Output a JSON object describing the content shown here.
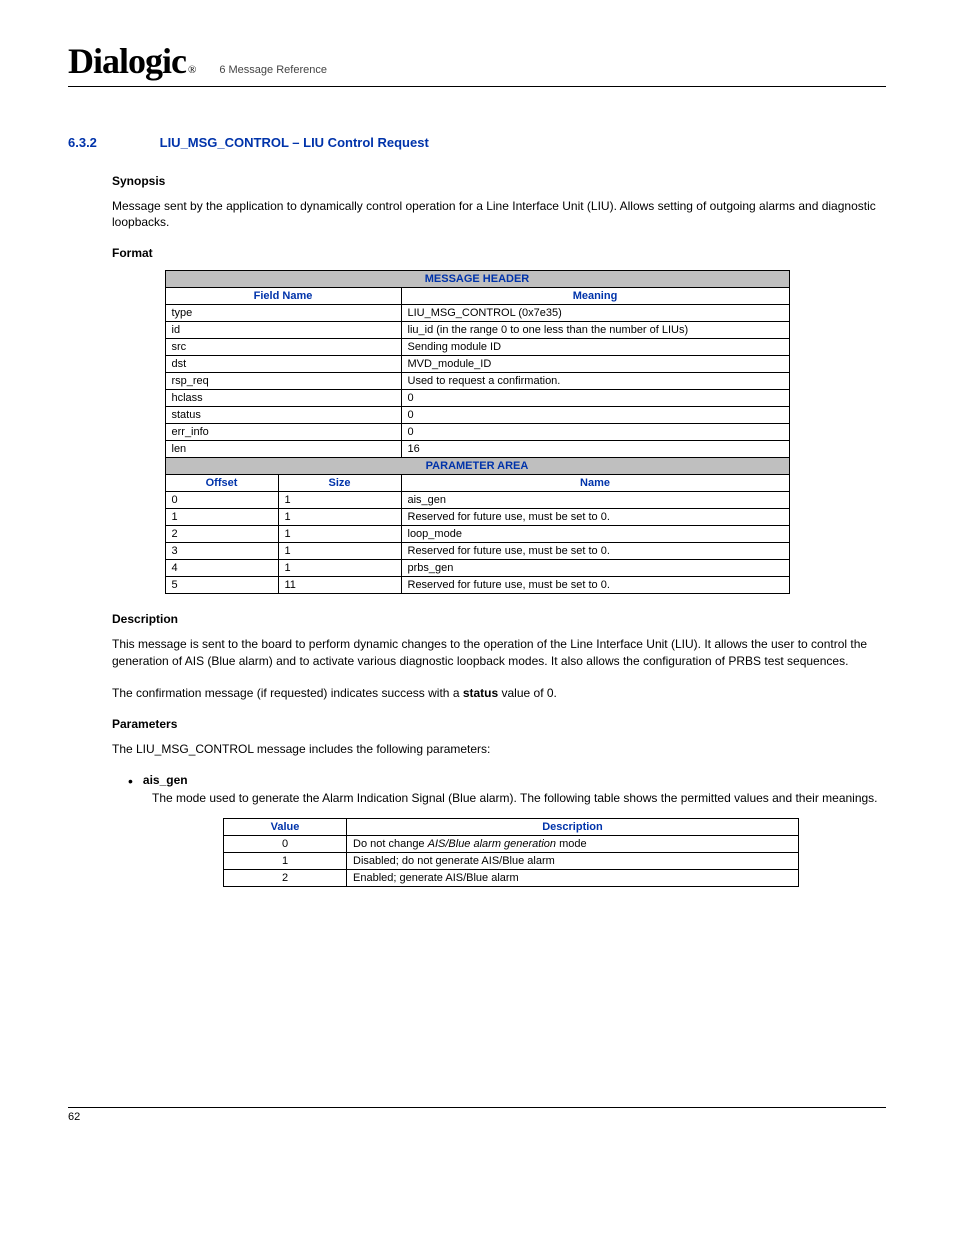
{
  "header": {
    "logo": "Dialogic",
    "breadcrumb": "6 Message Reference"
  },
  "section": {
    "number": "6.3.2",
    "title": "LIU_MSG_CONTROL – LIU Control Request"
  },
  "synopsis": {
    "heading": "Synopsis",
    "text": "Message sent by the application to dynamically control operation for a Line Interface Unit (LIU). Allows setting of outgoing alarms and diagnostic loopbacks."
  },
  "format": {
    "heading": "Format",
    "message_header_band": "MESSAGE HEADER",
    "cols": {
      "field": "Field Name",
      "meaning": "Meaning"
    },
    "rows": [
      {
        "field": "type",
        "meaning": "LIU_MSG_CONTROL (0x7e35)"
      },
      {
        "field": "id",
        "meaning": "liu_id (in the range 0 to one less than the number of LIUs)"
      },
      {
        "field": "src",
        "meaning": "Sending module ID"
      },
      {
        "field": "dst",
        "meaning": "MVD_module_ID"
      },
      {
        "field": "rsp_req",
        "meaning": "Used to request a confirmation."
      },
      {
        "field": "hclass",
        "meaning": "0"
      },
      {
        "field": "status",
        "meaning": "0"
      },
      {
        "field": "err_info",
        "meaning": "0"
      },
      {
        "field": "len",
        "meaning": "16"
      }
    ],
    "parameter_area_band": "PARAMETER AREA",
    "pcols": {
      "offset": "Offset",
      "size": "Size",
      "name": "Name"
    },
    "prows": [
      {
        "offset": "0",
        "size": "1",
        "name": "ais_gen"
      },
      {
        "offset": "1",
        "size": "1",
        "name": "Reserved for future use, must be set to 0."
      },
      {
        "offset": "2",
        "size": "1",
        "name": "loop_mode"
      },
      {
        "offset": "3",
        "size": "1",
        "name": "Reserved for future use, must be set to 0."
      },
      {
        "offset": "4",
        "size": "1",
        "name": "prbs_gen"
      },
      {
        "offset": "5",
        "size": "11",
        "name": "Reserved for future use, must be set to 0."
      }
    ]
  },
  "description": {
    "heading": "Description",
    "p1": "This message is sent to the board to perform dynamic changes to the operation of the Line Interface Unit (LIU). It allows the user to control the generation of AIS (Blue alarm) and to activate various diagnostic loopback modes. It also allows the configuration of PRBS test sequences.",
    "p2_pre": "The confirmation message (if requested) indicates success with a ",
    "p2_bold": "status",
    "p2_post": " value of 0."
  },
  "parameters": {
    "heading": "Parameters",
    "intro": "The LIU_MSG_CONTROL message includes the following parameters:",
    "item": {
      "name": "ais_gen",
      "text": "The mode used to generate the Alarm Indication Signal (Blue alarm). The following table shows the permitted values and their meanings."
    },
    "table": {
      "cols": {
        "value": "Value",
        "desc": "Description"
      },
      "rows": [
        {
          "value": "0",
          "desc_pre": "Do not change ",
          "desc_italic": "AIS/Blue alarm generation",
          "desc_post": " mode"
        },
        {
          "value": "1",
          "desc_pre": "Disabled; do not generate AIS/Blue alarm",
          "desc_italic": "",
          "desc_post": ""
        },
        {
          "value": "2",
          "desc_pre": "Enabled; generate AIS/Blue alarm",
          "desc_italic": "",
          "desc_post": ""
        }
      ]
    }
  },
  "footer": {
    "page": "62"
  }
}
